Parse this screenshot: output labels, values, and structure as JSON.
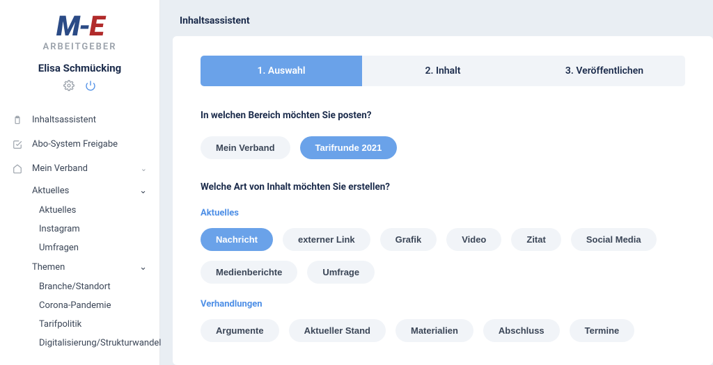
{
  "brand": {
    "sub": "ARBEITGEBER"
  },
  "user": {
    "name": "Elisa Schmücking"
  },
  "nav": {
    "item0": "Inhaltsassistent",
    "item1": "Abo-System Freigabe",
    "item2": "Mein Verband",
    "item2a": "Aktuelles",
    "item2a0": "Aktuelles",
    "item2a1": "Instagram",
    "item2a2": "Umfragen",
    "item2b": "Themen",
    "item2b0": "Branche/Standort",
    "item2b1": "Corona-Pandemie",
    "item2b2": "Tarifpolitik",
    "item2b3": "Digitalisierung/Strukturwandel"
  },
  "page": {
    "title": "Inhaltsassistent"
  },
  "steps": {
    "s1": "1. Auswahl",
    "s2": "2. Inhalt",
    "s3": "3. Veröffentlichen"
  },
  "q1": "In welchen Bereich möchten Sie posten?",
  "areas": {
    "a0": "Mein Verband",
    "a1": "Tarifrunde 2021"
  },
  "q2": "Welche Art von Inhalt möchten Sie erstellen?",
  "sec1": "Aktuelles",
  "types1": {
    "t0": "Nachricht",
    "t1": "externer Link",
    "t2": "Grafik",
    "t3": "Video",
    "t4": "Zitat",
    "t5": "Social Media",
    "t6": "Medienberichte",
    "t7": "Umfrage"
  },
  "sec2": "Verhandlungen",
  "types2": {
    "t0": "Argumente",
    "t1": "Aktueller Stand",
    "t2": "Materialien",
    "t3": "Abschluss",
    "t4": "Termine"
  }
}
